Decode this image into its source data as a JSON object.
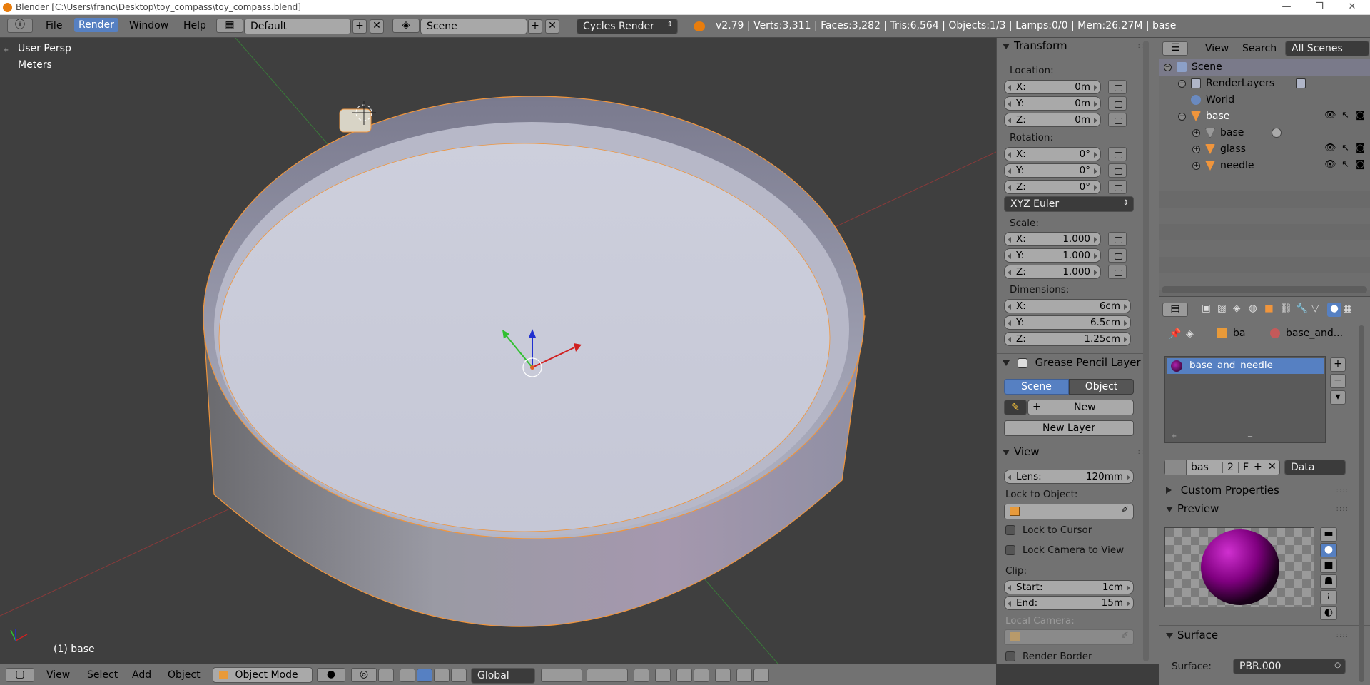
{
  "window": {
    "title": "Blender [C:\\Users\\franc\\Desktop\\toy_compass\\toy_compass.blend]",
    "minimize": "—",
    "maximize": "❐",
    "close": "✕"
  },
  "topbar": {
    "menus": [
      "File",
      "Render",
      "Window",
      "Help"
    ],
    "active_menu": "Render",
    "layout": "Default",
    "scene": "Scene",
    "engine": "Cycles Render",
    "stats": "v2.79 | Verts:3,311 | Faces:3,282 | Tris:6,564 | Objects:1/3 | Lamps:0/0 | Mem:26.27M | base"
  },
  "viewport": {
    "view_name": "User Persp",
    "units": "Meters",
    "active_object": "(1) base"
  },
  "npanel": {
    "transform": {
      "title": "Transform",
      "location_label": "Location:",
      "location": [
        {
          "k": "X:",
          "v": "0m"
        },
        {
          "k": "Y:",
          "v": "0m"
        },
        {
          "k": "Z:",
          "v": "0m"
        }
      ],
      "rotation_label": "Rotation:",
      "rotation": [
        {
          "k": "X:",
          "v": "0°"
        },
        {
          "k": "Y:",
          "v": "0°"
        },
        {
          "k": "Z:",
          "v": "0°"
        }
      ],
      "rotation_mode": "XYZ Euler",
      "scale_label": "Scale:",
      "scale": [
        {
          "k": "X:",
          "v": "1.000"
        },
        {
          "k": "Y:",
          "v": "1.000"
        },
        {
          "k": "Z:",
          "v": "1.000"
        }
      ],
      "dimensions_label": "Dimensions:",
      "dimensions": [
        {
          "k": "X:",
          "v": "6cm"
        },
        {
          "k": "Y:",
          "v": "6.5cm"
        },
        {
          "k": "Z:",
          "v": "1.25cm"
        }
      ]
    },
    "grease_pencil": {
      "title": "Grease Pencil Layer",
      "tab_scene": "Scene",
      "tab_object": "Object",
      "new_label": "New",
      "new_layer_label": "New Layer"
    },
    "view": {
      "title": "View",
      "lens_label": "Lens:",
      "lens_value": "120mm",
      "lock_to_object": "Lock to Object:",
      "lock_cursor": "Lock to Cursor",
      "lock_camera": "Lock Camera to View",
      "clip_label": "Clip:",
      "clip_start_label": "Start:",
      "clip_start": "1cm",
      "clip_end_label": "End:",
      "clip_end": "15m",
      "local_camera": "Local Camera:",
      "render_border": "Render Border"
    }
  },
  "outliner": {
    "view_menu": "View",
    "search_menu": "Search",
    "filter": "All Scenes",
    "items": [
      {
        "label": "Scene"
      },
      {
        "label": "RenderLayers"
      },
      {
        "label": "World"
      },
      {
        "label": "base"
      },
      {
        "label": "base"
      },
      {
        "label": "glass"
      },
      {
        "label": "needle"
      }
    ]
  },
  "properties": {
    "breadcrumb_obj": "ba",
    "breadcrumb_mat": "base_and...",
    "material_slot": "base_and_needle",
    "datablock_name": "bas",
    "user_count": "2",
    "fake_user": "F",
    "link_mode": "Data",
    "custom_props": "Custom Properties",
    "preview": "Preview",
    "surface_title": "Surface",
    "surface_label": "Surface:",
    "surface_value": "PBR.000"
  },
  "bottombar": {
    "menus": [
      "View",
      "Select",
      "Add",
      "Object"
    ],
    "mode": "Object Mode",
    "orientation": "Global"
  },
  "colors": {
    "accent": "#5680c2",
    "selection_orange": "#f0953c",
    "viewport_bg": "#3f3f3f",
    "panel_bg": "#727272"
  }
}
